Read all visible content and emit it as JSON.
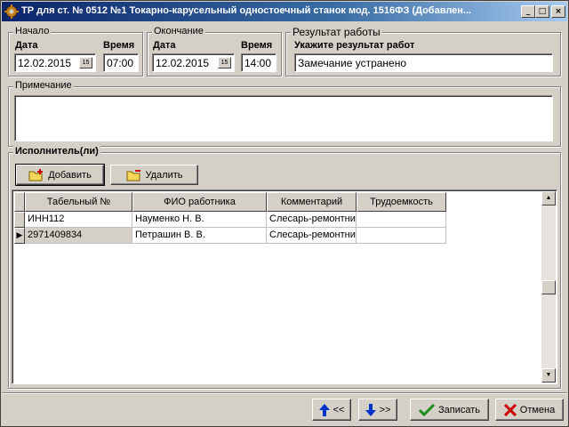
{
  "window": {
    "title": "ТР  для ст. № 0512 №1 Токарно-карусельный одностоечный станок мод. 1516ФЗ (Добавлен...",
    "minimize": "_",
    "maximize": "□",
    "close": "×"
  },
  "start": {
    "group": "Начало",
    "date_label": "Дата",
    "date": "12.02.2015",
    "time_label": "Время",
    "time": "07:00",
    "cal": "15"
  },
  "end": {
    "group": "Окончание",
    "date_label": "Дата",
    "date": "12.02.2015",
    "time_label": "Время",
    "time": "14:00",
    "cal": "15"
  },
  "result": {
    "group": "Результат работы",
    "label": "Укажите результат работ",
    "value": "Замечание устранено"
  },
  "note": {
    "group": "Примечание",
    "value": ""
  },
  "executors": {
    "group": "Исполнитель(ли)",
    "add_label": "Добавить",
    "delete_label": "Удалить",
    "columns": [
      "Табельный №",
      "ФИО работника",
      "Комментарий",
      "Трудоемкость"
    ],
    "rows": [
      {
        "tab": "ИНН112",
        "name": "Науменко Н. В.",
        "comment": "Слесарь-ремонтни",
        "labor": ""
      },
      {
        "tab": "2971409834",
        "name": "Петрашин В. В.",
        "comment": "Слесарь-ремонтни",
        "labor": ""
      }
    ],
    "current_row_marker": "▶"
  },
  "footer": {
    "prev_label": "<<",
    "next_label": ">>",
    "save_label": "Записать",
    "cancel_label": "Отмена"
  },
  "colors": {
    "title_start": "#0a246a",
    "title_end": "#a6caf0",
    "face": "#d4d0c8",
    "arrow_blue": "#0033cc",
    "save_green": "#1a8f1a",
    "cancel_red": "#cc0000"
  }
}
